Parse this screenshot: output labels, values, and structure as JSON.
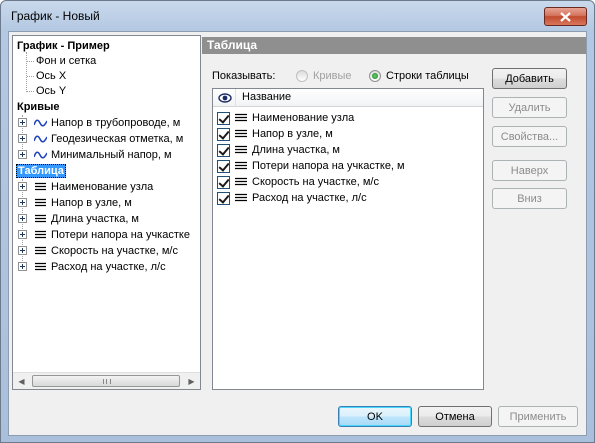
{
  "window": {
    "title": "График - Новый"
  },
  "tree": {
    "root": "График - Пример",
    "root_children": [
      "Фон и сетка",
      "Ось X",
      "Ось Y"
    ],
    "curves_label": "Кривые",
    "curves": [
      "Напор в трубопроводе, м",
      "Геодезическая отметка, м",
      "Минимальный напор, м"
    ],
    "table_label": "Таблица",
    "table_items": [
      "Наименование узла",
      "Напор в узле, м",
      "Длина участка, м",
      "Потери напора на учкастке",
      "Скорость на участке, м/с",
      "Расход на участке, л/с"
    ],
    "scroll_grip": "III"
  },
  "panel": {
    "title": "Таблица",
    "show_label": "Показывать:",
    "radio_curves": "Кривые",
    "radio_rows": "Строки таблицы",
    "radio_selected": "rows",
    "column_name": "Название",
    "rows": [
      {
        "label": "Наименование узла",
        "checked": true
      },
      {
        "label": "Напор в узле, м",
        "checked": true
      },
      {
        "label": "Длина участка, м",
        "checked": true
      },
      {
        "label": "Потери напора на учкастке, м",
        "checked": true
      },
      {
        "label": "Скорость на участке, м/с",
        "checked": true
      },
      {
        "label": "Расход на участке, л/с",
        "checked": true
      }
    ]
  },
  "buttons": {
    "add": "Добавить",
    "delete": "Удалить",
    "properties": "Свойства...",
    "up": "Наверх",
    "down": "Вниз",
    "ok": "OK",
    "cancel": "Отмена",
    "apply": "Применить"
  },
  "colors": {
    "selection": "#3399ff",
    "panel_header": "#8f8f8f",
    "curve_icon": "#1f3fbf"
  }
}
